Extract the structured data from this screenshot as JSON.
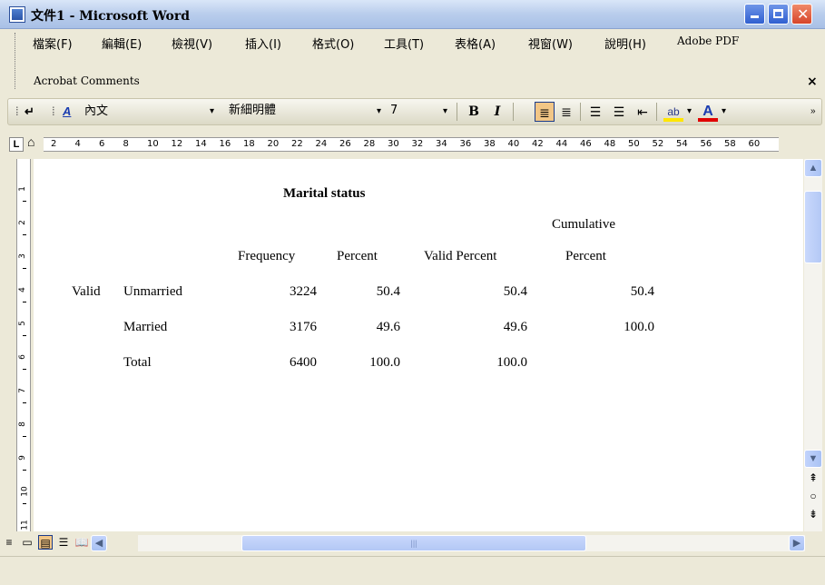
{
  "window": {
    "title": "文件1 - Microsoft Word"
  },
  "menu": {
    "items": [
      "檔案(F)",
      "編輯(E)",
      "檢視(V)",
      "插入(I)",
      "格式(O)",
      "工具(T)",
      "表格(A)",
      "視窗(W)",
      "說明(H)",
      "Adobe PDF"
    ],
    "row2": "Acrobat Comments",
    "close": "×"
  },
  "toolbar": {
    "style_name": "內文",
    "font_name": "新細明體",
    "font_size": "7",
    "bold": "B",
    "italic": "I"
  },
  "ruler": {
    "numbers": [
      "2",
      "4",
      "6",
      "8",
      "10",
      "12",
      "14",
      "16",
      "18",
      "20",
      "22",
      "24",
      "26",
      "28",
      "30",
      "32",
      "34",
      "36",
      "38",
      "40",
      "42",
      "44",
      "46",
      "48",
      "50",
      "52",
      "54",
      "56",
      "58",
      "60"
    ],
    "vnumbers": [
      "1",
      "2",
      "3",
      "4",
      "5",
      "6",
      "7",
      "8",
      "9",
      "10",
      "11"
    ]
  },
  "table": {
    "title": "Marital status",
    "header_top": "Cumulative",
    "headers": [
      "Frequency",
      "Percent",
      "Valid Percent",
      "Percent"
    ],
    "row_group": "Valid",
    "rows": [
      {
        "label": "Unmarried",
        "frequency": "3224",
        "percent": "50.4",
        "valid_percent": "50.4",
        "cumulative": "50.4"
      },
      {
        "label": "Married",
        "frequency": "3176",
        "percent": "49.6",
        "valid_percent": "49.6",
        "cumulative": "100.0"
      },
      {
        "label": "Total",
        "frequency": "6400",
        "percent": "100.0",
        "valid_percent": "100.0",
        "cumulative": ""
      }
    ]
  },
  "colors": {
    "titlebar": "#b9cdec",
    "close_button": "#d6452a",
    "active_button": "#f2c686"
  }
}
